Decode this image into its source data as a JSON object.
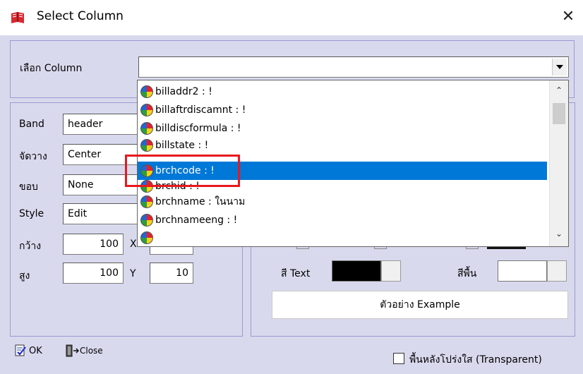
{
  "window": {
    "title": "Select Column",
    "close_glyph": "✕"
  },
  "column_select": {
    "label": "เลือก Column",
    "value": ""
  },
  "dropdown": {
    "items": [
      {
        "text": "billaddr2 : !",
        "selected": false
      },
      {
        "text": "billaftrdiscamnt : !",
        "selected": false
      },
      {
        "text": "billdiscformula : !",
        "selected": false
      },
      {
        "text": "billstate : !",
        "selected": false
      },
      {
        "text": "brchcode : !",
        "selected": true
      },
      {
        "text": "brchid : !",
        "selected": false
      },
      {
        "text": "brchname :  ในนาม",
        "selected": false
      },
      {
        "text": "brchnameeng : !",
        "selected": false
      }
    ],
    "item_icon": "color-ball-icon",
    "highlight_color": "#0078d7",
    "annotation_color": "#e8181f"
  },
  "properties": {
    "band": {
      "label": "Band",
      "value": "header"
    },
    "align": {
      "label": "จัดวาง",
      "value": "Center"
    },
    "border": {
      "label": "ขอบ",
      "value": "None"
    },
    "style": {
      "label": "Style",
      "value": "Edit"
    },
    "width": {
      "label": "กว้าง",
      "value": "100"
    },
    "x": {
      "label": "X",
      "value": ""
    },
    "height": {
      "label": "สูง",
      "value": "100"
    },
    "y": {
      "label": "Y",
      "value": "10"
    }
  },
  "colors": {
    "text_color": {
      "label": "สี Text",
      "value": "#000000"
    },
    "background_color": {
      "label": "สีพื้น",
      "value": "#ffffff"
    }
  },
  "example": {
    "text": "ตัวอย่าง Example"
  },
  "buttons": {
    "ok": "OK",
    "close": "Close"
  },
  "transparent": {
    "label": "พื้นหลังโปร่งใส (Transparent)",
    "checked": false
  }
}
